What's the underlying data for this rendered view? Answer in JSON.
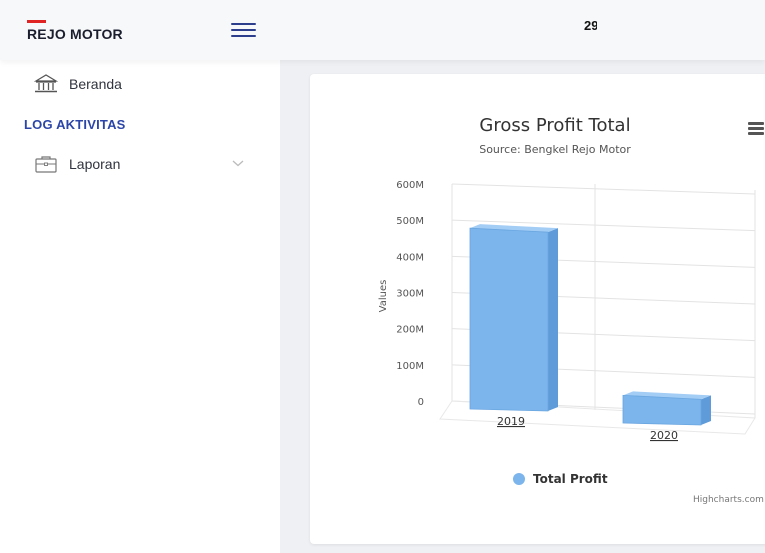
{
  "header": {
    "brand": "REJO MOTOR",
    "clipped_text": "29"
  },
  "sidebar": {
    "items": [
      {
        "label": "Beranda",
        "icon": "bank-icon"
      }
    ],
    "section_title": "LOG AKTIVITAS",
    "section_items": [
      {
        "label": "Laporan",
        "icon": "briefcase-icon",
        "has_submenu": true
      }
    ]
  },
  "colors": {
    "brand_red": "#e02424",
    "accent_blue": "#2b46a8",
    "series": "#7cb5ec"
  },
  "chart": {
    "title": "Gross Profit Total",
    "subtitle": "Source: Bengkel Rejo Motor",
    "legend_label": "Total Profit",
    "credits": "Highcharts.com"
  },
  "chart_data": {
    "type": "bar",
    "rendering": "3d-column",
    "title": "Gross Profit Total",
    "subtitle": "Source: Bengkel Rejo Motor",
    "xlabel": "",
    "ylabel": "Values",
    "categories": [
      "2019",
      "2020"
    ],
    "series": [
      {
        "name": "Total Profit",
        "values": [
          500000000,
          35000000
        ]
      }
    ],
    "y_ticks": [
      "0",
      "100M",
      "200M",
      "300M",
      "400M",
      "500M",
      "600M"
    ],
    "ylim": [
      0,
      600000000
    ],
    "grid": true,
    "legend": "bottom-center"
  }
}
